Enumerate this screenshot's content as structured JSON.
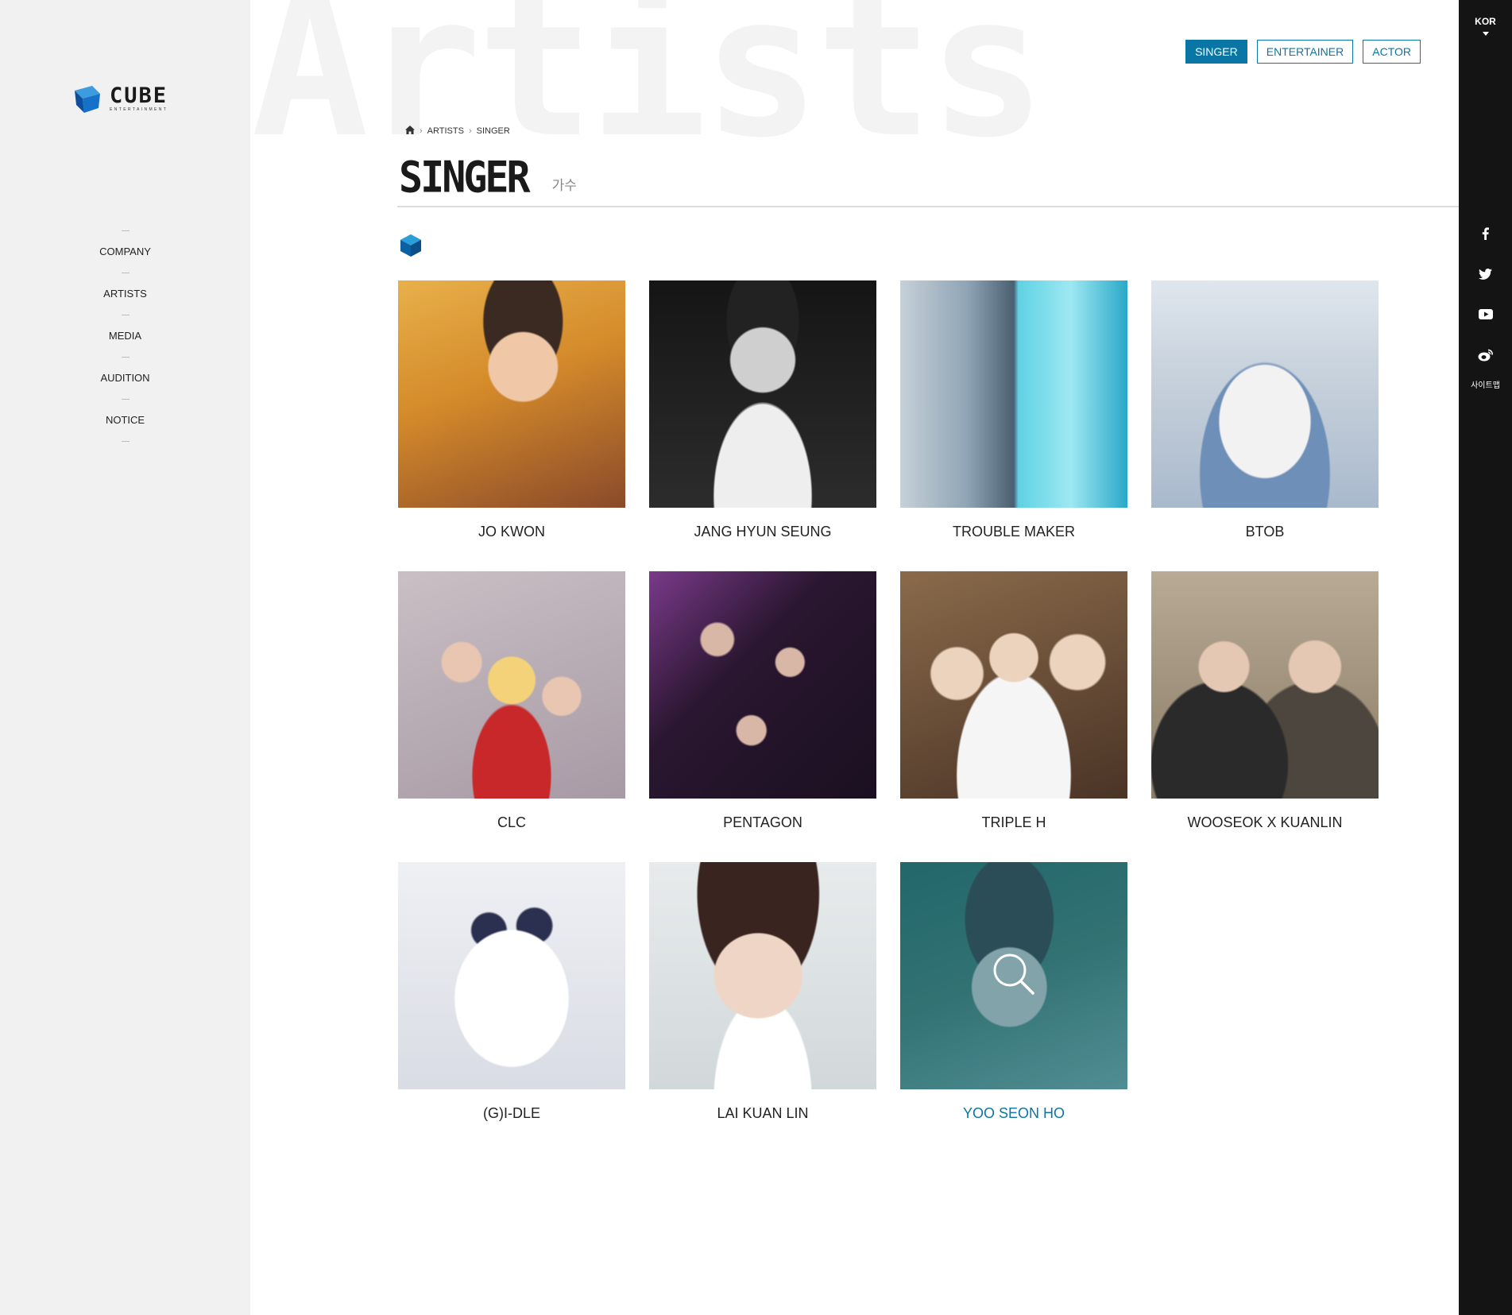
{
  "logo": {
    "word": "CUBE",
    "sub": "ENTERTAINMENT"
  },
  "nav": [
    {
      "label": "COMPANY"
    },
    {
      "label": "ARTISTS"
    },
    {
      "label": "MEDIA"
    },
    {
      "label": "AUDITION"
    },
    {
      "label": "NOTICE"
    }
  ],
  "background_word": "Artists",
  "tabs": [
    {
      "label": "SINGER",
      "active": true
    },
    {
      "label": "ENTERTAINER",
      "active": false
    },
    {
      "label": "ACTOR",
      "active": false
    }
  ],
  "breadcrumb": {
    "level1": "ARTISTS",
    "level2": "SINGER"
  },
  "page": {
    "title": "SINGER",
    "subtitle": "가수"
  },
  "artists": [
    {
      "name": "JO KWON"
    },
    {
      "name": "JANG HYUN SEUNG"
    },
    {
      "name": "TROUBLE MAKER"
    },
    {
      "name": "BTOB"
    },
    {
      "name": "CLC"
    },
    {
      "name": "PENTAGON"
    },
    {
      "name": "TRIPLE H"
    },
    {
      "name": "WOOSEOK X KUANLIN"
    },
    {
      "name": "(G)I-DLE"
    },
    {
      "name": "LAI KUAN LIN"
    },
    {
      "name": "YOO SEON HO"
    }
  ],
  "rightbar": {
    "language": "KOR",
    "sitemap": "사이트맵"
  },
  "colors": {
    "accent": "#0a76a6",
    "sidebar_bg": "#f1f1f1",
    "rightbar_bg": "#141414"
  }
}
